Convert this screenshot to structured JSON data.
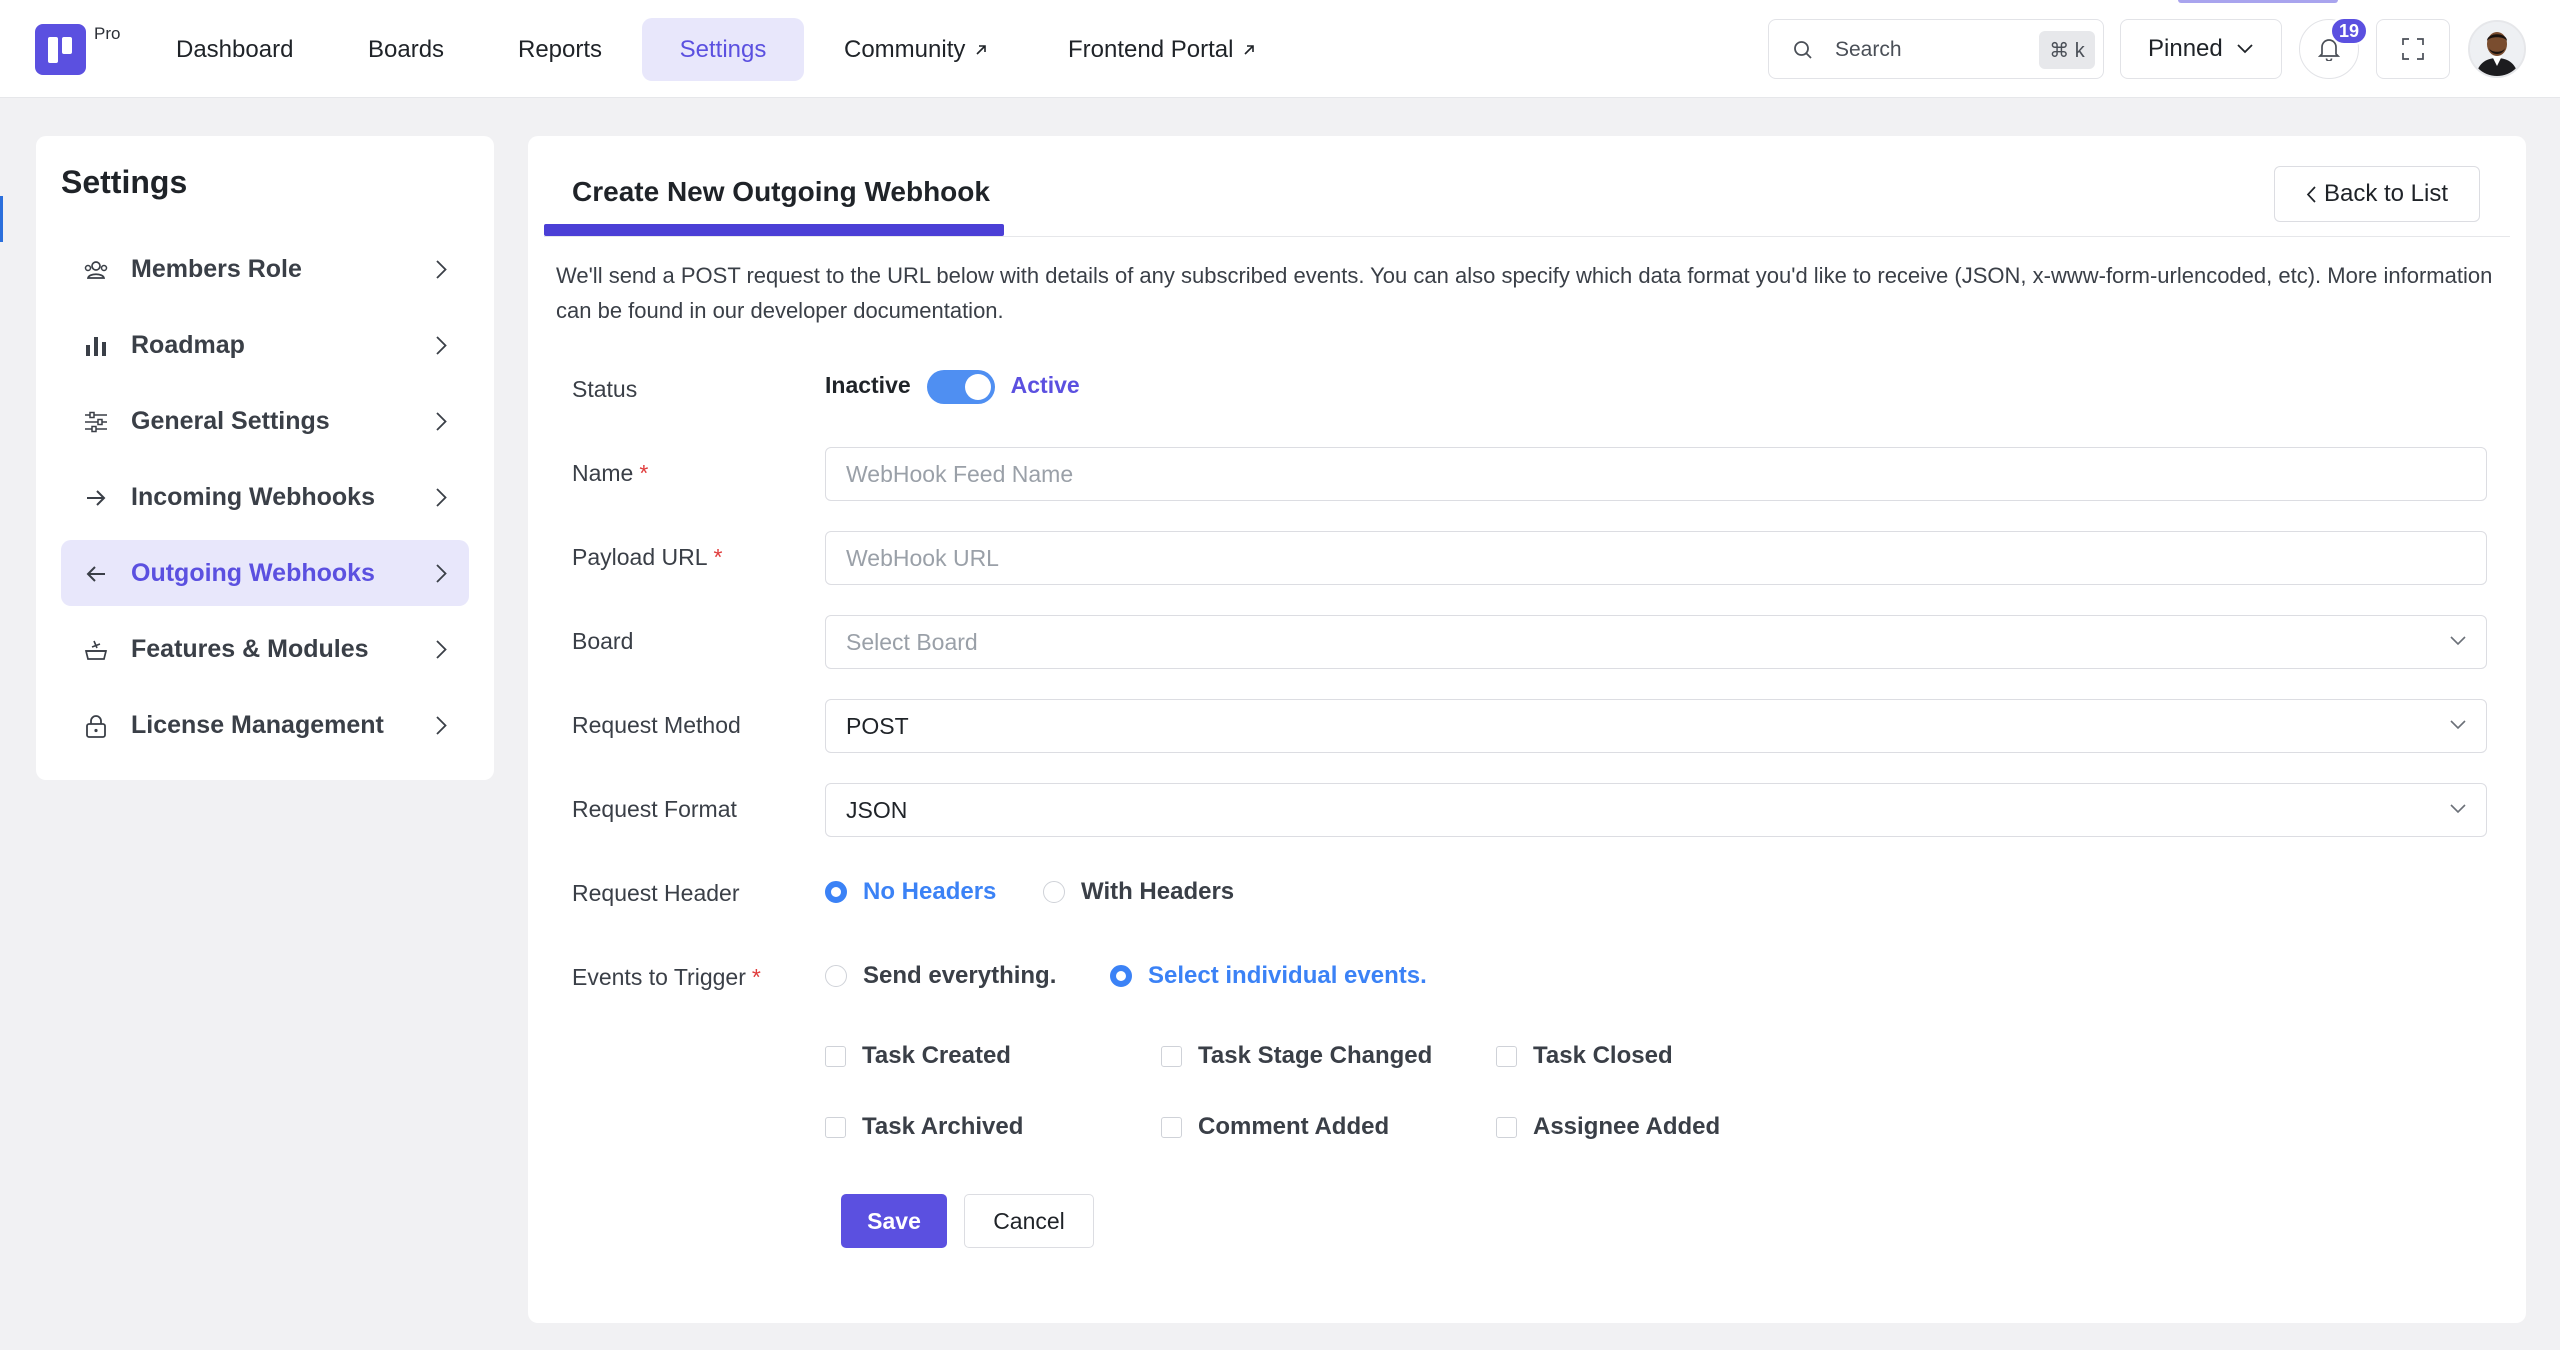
{
  "header": {
    "logo_badge": "Pro",
    "nav": [
      {
        "label": "Dashboard",
        "external": false
      },
      {
        "label": "Boards",
        "external": false
      },
      {
        "label": "Reports",
        "external": false
      },
      {
        "label": "Settings",
        "external": false,
        "active": true
      },
      {
        "label": "Community",
        "external": true
      },
      {
        "label": "Frontend Portal",
        "external": true
      }
    ],
    "search": {
      "placeholder": "Search",
      "shortcut": "⌘ k"
    },
    "pinned_label": "Pinned",
    "notification_count": "19",
    "accent_color": "#5b50e0"
  },
  "sidebar": {
    "title": "Settings",
    "items": [
      {
        "label": "Members Role",
        "icon": "users-icon"
      },
      {
        "label": "Roadmap",
        "icon": "bar-chart-icon"
      },
      {
        "label": "General Settings",
        "icon": "sliders-icon"
      },
      {
        "label": "Incoming Webhooks",
        "icon": "arrow-right-icon"
      },
      {
        "label": "Outgoing Webhooks",
        "icon": "arrow-left-icon",
        "active": true
      },
      {
        "label": "Features & Modules",
        "icon": "modules-icon"
      },
      {
        "label": "License Management",
        "icon": "lock-icon"
      }
    ]
  },
  "main": {
    "title": "Create New Outgoing Webhook",
    "back_label": "Back to List",
    "intro": "We'll send a POST request to the URL below with details of any subscribed events. You can also specify which data format you'd like to receive (JSON, x-www-form-urlencoded, etc). More information can be found in our developer documentation.",
    "form": {
      "status": {
        "label": "Status",
        "off_label": "Inactive",
        "on_label": "Active",
        "value": true
      },
      "name": {
        "label": "Name",
        "required": "*",
        "placeholder": "WebHook Feed Name",
        "value": ""
      },
      "payload_url": {
        "label": "Payload URL",
        "required": "*",
        "placeholder": "WebHook URL",
        "value": ""
      },
      "board": {
        "label": "Board",
        "placeholder": "Select Board"
      },
      "request_method": {
        "label": "Request Method",
        "value": "POST"
      },
      "request_format": {
        "label": "Request Format",
        "value": "JSON"
      },
      "request_header": {
        "label": "Request Header",
        "options": [
          "No Headers",
          "With Headers"
        ],
        "selected": "No Headers"
      },
      "events": {
        "label": "Events to Trigger",
        "required": "*",
        "options": [
          "Send everything.",
          "Select individual events."
        ],
        "selected": "Select individual events.",
        "checkboxes": [
          "Task Created",
          "Task Stage Changed",
          "Task Closed",
          "Task Archived",
          "Comment Added",
          "Assignee Added"
        ]
      }
    },
    "save_label": "Save",
    "cancel_label": "Cancel"
  }
}
